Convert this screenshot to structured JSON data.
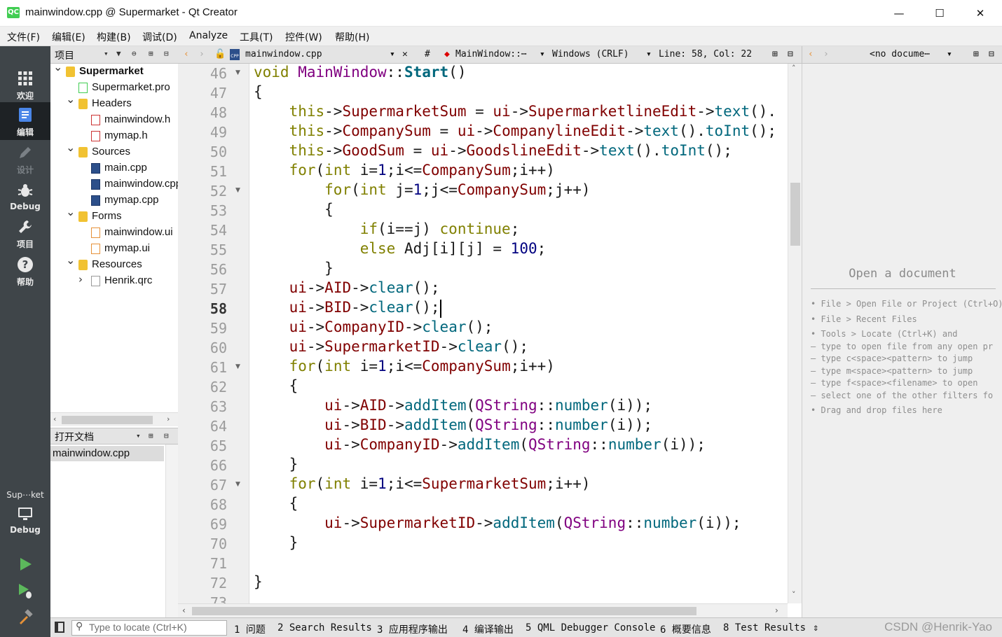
{
  "window": {
    "title": "mainwindow.cpp @ Supermarket - Qt Creator",
    "app_icon": "QC",
    "controls": [
      "—",
      "☐",
      "✕"
    ]
  },
  "menu": [
    "文件(F)",
    "编辑(E)",
    "构建(B)",
    "调试(D)",
    "Analyze",
    "工具(T)",
    "控件(W)",
    "帮助(H)"
  ],
  "modes": [
    {
      "label": "欢迎",
      "icon": "grid-icon"
    },
    {
      "label": "编辑",
      "icon": "edit-icon"
    },
    {
      "label": "设计",
      "icon": "pencil-icon"
    },
    {
      "label": "Debug",
      "icon": "bug-icon"
    },
    {
      "label": "项目",
      "icon": "wrench-icon"
    },
    {
      "label": "帮助",
      "icon": "help-icon"
    }
  ],
  "kit": {
    "name": "Sup⋯ket",
    "label": "Debug"
  },
  "project_panel": {
    "title": "项目",
    "tree": [
      {
        "label": "Supermarket",
        "depth": 0,
        "type": "project",
        "expanded": true
      },
      {
        "label": "Supermarket.pro",
        "depth": 1,
        "type": "pro"
      },
      {
        "label": "Headers",
        "depth": 1,
        "type": "folder",
        "expanded": true
      },
      {
        "label": "mainwindow.h",
        "depth": 2,
        "type": "h"
      },
      {
        "label": "mymap.h",
        "depth": 2,
        "type": "h"
      },
      {
        "label": "Sources",
        "depth": 1,
        "type": "folder",
        "expanded": true
      },
      {
        "label": "main.cpp",
        "depth": 2,
        "type": "cpp"
      },
      {
        "label": "mainwindow.cpp",
        "depth": 2,
        "type": "cpp"
      },
      {
        "label": "mymap.cpp",
        "depth": 2,
        "type": "cpp"
      },
      {
        "label": "Forms",
        "depth": 1,
        "type": "folder",
        "expanded": true
      },
      {
        "label": "mainwindow.ui",
        "depth": 2,
        "type": "ui"
      },
      {
        "label": "mymap.ui",
        "depth": 2,
        "type": "ui"
      },
      {
        "label": "Resources",
        "depth": 1,
        "type": "folder",
        "expanded": true
      },
      {
        "label": "Henrik.qrc",
        "depth": 2,
        "type": "qrc",
        "collapsed": true
      }
    ]
  },
  "open_documents": {
    "title": "打开文档",
    "items": [
      "mainwindow.cpp"
    ]
  },
  "editor": {
    "file": "mainwindow.cpp",
    "symbol": "MainWindow::⋯",
    "encoding": "Windows (CRLF)",
    "position": "Line: 58, Col: 22",
    "current_line": 58,
    "lines": [
      {
        "n": 46,
        "fold": true,
        "tokens": [
          [
            "kw",
            "void "
          ],
          [
            "ty",
            "MainWindow"
          ],
          [
            "",
            "::"
          ],
          [
            "fnb",
            "Start"
          ],
          [
            "",
            "()"
          ]
        ]
      },
      {
        "n": 47,
        "tokens": [
          [
            "",
            "{"
          ]
        ]
      },
      {
        "n": 48,
        "tokens": [
          [
            "",
            "    "
          ],
          [
            "kw",
            "this"
          ],
          [
            "",
            "->"
          ],
          [
            "mem",
            "SupermarketSum"
          ],
          [
            "",
            " = "
          ],
          [
            "mem",
            "ui"
          ],
          [
            "",
            "->"
          ],
          [
            "mem",
            "SupermarketlineEdit"
          ],
          [
            "",
            "->"
          ],
          [
            "fn",
            "text"
          ],
          [
            "",
            "()."
          ]
        ]
      },
      {
        "n": 49,
        "tokens": [
          [
            "",
            "    "
          ],
          [
            "kw",
            "this"
          ],
          [
            "",
            "->"
          ],
          [
            "mem",
            "CompanySum"
          ],
          [
            "",
            " = "
          ],
          [
            "mem",
            "ui"
          ],
          [
            "",
            "->"
          ],
          [
            "mem",
            "CompanylineEdit"
          ],
          [
            "",
            "->"
          ],
          [
            "fn",
            "text"
          ],
          [
            "",
            "()."
          ],
          [
            "fn",
            "toInt"
          ],
          [
            "",
            "();"
          ]
        ]
      },
      {
        "n": 50,
        "tokens": [
          [
            "",
            "    "
          ],
          [
            "kw",
            "this"
          ],
          [
            "",
            "->"
          ],
          [
            "mem",
            "GoodSum"
          ],
          [
            "",
            " = "
          ],
          [
            "mem",
            "ui"
          ],
          [
            "",
            "->"
          ],
          [
            "mem",
            "GoodslineEdit"
          ],
          [
            "",
            "->"
          ],
          [
            "fn",
            "text"
          ],
          [
            "",
            "()."
          ],
          [
            "fn",
            "toInt"
          ],
          [
            "",
            "();"
          ]
        ]
      },
      {
        "n": 51,
        "tokens": [
          [
            "",
            "    "
          ],
          [
            "kw",
            "for"
          ],
          [
            "",
            "("
          ],
          [
            "kw",
            "int"
          ],
          [
            "",
            " i="
          ],
          [
            "num",
            "1"
          ],
          [
            "",
            ";i<="
          ],
          [
            "mem",
            "CompanySum"
          ],
          [
            "",
            ";i++)"
          ]
        ]
      },
      {
        "n": 52,
        "fold": true,
        "tokens": [
          [
            "",
            "        "
          ],
          [
            "kw",
            "for"
          ],
          [
            "",
            "("
          ],
          [
            "kw",
            "int"
          ],
          [
            "",
            " j="
          ],
          [
            "num",
            "1"
          ],
          [
            "",
            ";j<="
          ],
          [
            "mem",
            "CompanySum"
          ],
          [
            "",
            ";j++)"
          ]
        ]
      },
      {
        "n": 53,
        "tokens": [
          [
            "",
            "        {"
          ]
        ]
      },
      {
        "n": 54,
        "tokens": [
          [
            "",
            "            "
          ],
          [
            "kw",
            "if"
          ],
          [
            "",
            "(i==j) "
          ],
          [
            "kw",
            "continue"
          ],
          [
            "",
            ";"
          ]
        ]
      },
      {
        "n": 55,
        "tokens": [
          [
            "",
            "            "
          ],
          [
            "kw",
            "else"
          ],
          [
            "",
            " Adj[i][j] = "
          ],
          [
            "num",
            "100"
          ],
          [
            "",
            ";"
          ]
        ]
      },
      {
        "n": 56,
        "tokens": [
          [
            "",
            "        }"
          ]
        ]
      },
      {
        "n": 57,
        "tokens": [
          [
            "",
            "    "
          ],
          [
            "mem",
            "ui"
          ],
          [
            "",
            "->"
          ],
          [
            "mem",
            "AID"
          ],
          [
            "",
            "->"
          ],
          [
            "fn",
            "clear"
          ],
          [
            "",
            "();"
          ]
        ]
      },
      {
        "n": 58,
        "tokens": [
          [
            "",
            "    "
          ],
          [
            "mem",
            "ui"
          ],
          [
            "",
            "->"
          ],
          [
            "mem",
            "BID"
          ],
          [
            "",
            "->"
          ],
          [
            "fn",
            "clear"
          ],
          [
            "",
            "();"
          ]
        ]
      },
      {
        "n": 59,
        "tokens": [
          [
            "",
            "    "
          ],
          [
            "mem",
            "ui"
          ],
          [
            "",
            "->"
          ],
          [
            "mem",
            "CompanyID"
          ],
          [
            "",
            "->"
          ],
          [
            "fn",
            "clear"
          ],
          [
            "",
            "();"
          ]
        ]
      },
      {
        "n": 60,
        "tokens": [
          [
            "",
            "    "
          ],
          [
            "mem",
            "ui"
          ],
          [
            "",
            "->"
          ],
          [
            "mem",
            "SupermarketID"
          ],
          [
            "",
            "->"
          ],
          [
            "fn",
            "clear"
          ],
          [
            "",
            "();"
          ]
        ]
      },
      {
        "n": 61,
        "fold": true,
        "tokens": [
          [
            "",
            "    "
          ],
          [
            "kw",
            "for"
          ],
          [
            "",
            "("
          ],
          [
            "kw",
            "int"
          ],
          [
            "",
            " i="
          ],
          [
            "num",
            "1"
          ],
          [
            "",
            ";i<="
          ],
          [
            "mem",
            "CompanySum"
          ],
          [
            "",
            ";i++)"
          ]
        ]
      },
      {
        "n": 62,
        "tokens": [
          [
            "",
            "    {"
          ]
        ]
      },
      {
        "n": 63,
        "tokens": [
          [
            "",
            "        "
          ],
          [
            "mem",
            "ui"
          ],
          [
            "",
            "->"
          ],
          [
            "mem",
            "AID"
          ],
          [
            "",
            "->"
          ],
          [
            "fn",
            "addItem"
          ],
          [
            "",
            "("
          ],
          [
            "ty",
            "QString"
          ],
          [
            "",
            "::"
          ],
          [
            "fn",
            "number"
          ],
          [
            "",
            "(i));"
          ]
        ]
      },
      {
        "n": 64,
        "tokens": [
          [
            "",
            "        "
          ],
          [
            "mem",
            "ui"
          ],
          [
            "",
            "->"
          ],
          [
            "mem",
            "BID"
          ],
          [
            "",
            "->"
          ],
          [
            "fn",
            "addItem"
          ],
          [
            "",
            "("
          ],
          [
            "ty",
            "QString"
          ],
          [
            "",
            "::"
          ],
          [
            "fn",
            "number"
          ],
          [
            "",
            "(i));"
          ]
        ]
      },
      {
        "n": 65,
        "tokens": [
          [
            "",
            "        "
          ],
          [
            "mem",
            "ui"
          ],
          [
            "",
            "->"
          ],
          [
            "mem",
            "CompanyID"
          ],
          [
            "",
            "->"
          ],
          [
            "fn",
            "addItem"
          ],
          [
            "",
            "("
          ],
          [
            "ty",
            "QString"
          ],
          [
            "",
            "::"
          ],
          [
            "fn",
            "number"
          ],
          [
            "",
            "(i));"
          ]
        ]
      },
      {
        "n": 66,
        "tokens": [
          [
            "",
            "    }"
          ]
        ]
      },
      {
        "n": 67,
        "fold": true,
        "tokens": [
          [
            "",
            "    "
          ],
          [
            "kw",
            "for"
          ],
          [
            "",
            "("
          ],
          [
            "kw",
            "int"
          ],
          [
            "",
            " i="
          ],
          [
            "num",
            "1"
          ],
          [
            "",
            ";i<="
          ],
          [
            "mem",
            "SupermarketSum"
          ],
          [
            "",
            ";i++)"
          ]
        ]
      },
      {
        "n": 68,
        "tokens": [
          [
            "",
            "    {"
          ]
        ]
      },
      {
        "n": 69,
        "tokens": [
          [
            "",
            "        "
          ],
          [
            "mem",
            "ui"
          ],
          [
            "",
            "->"
          ],
          [
            "mem",
            "SupermarketID"
          ],
          [
            "",
            "->"
          ],
          [
            "fn",
            "addItem"
          ],
          [
            "",
            "("
          ],
          [
            "ty",
            "QString"
          ],
          [
            "",
            "::"
          ],
          [
            "fn",
            "number"
          ],
          [
            "",
            "(i));"
          ]
        ]
      },
      {
        "n": 70,
        "tokens": [
          [
            "",
            "    }"
          ]
        ]
      },
      {
        "n": 71,
        "tokens": []
      },
      {
        "n": 72,
        "tokens": [
          [
            "",
            "}"
          ]
        ]
      },
      {
        "n": 73,
        "tokens": []
      }
    ]
  },
  "right_panel": {
    "selector": "<no docume⋯",
    "title": "Open a document",
    "hints": [
      "• File > Open File or Project (Ctrl+O)",
      "• File > Recent Files",
      "• Tools > Locate (Ctrl+K) and",
      "  – type to open file from any open pr",
      "  – type c<space><pattern> to jump",
      "  – type m<space><pattern> to jump",
      "  – type f<space><filename> to open",
      "  – select one of the other filters fo",
      "• Drag and drop files here"
    ]
  },
  "statusbar": {
    "locator_placeholder": "Type to locate (Ctrl+K)",
    "panes": [
      "1 问题",
      "2 Search Results",
      "3 应用程序输出",
      "4 编译输出",
      "5 QML Debugger Console",
      "6 概要信息",
      "8 Test Results"
    ],
    "watermark": "CSDN @Henrik-Yao"
  },
  "colors": {
    "modebar": "#3f4549",
    "keyword": "#808000",
    "type": "#800080",
    "member": "#800000",
    "function": "#00677c",
    "number": "#000080"
  }
}
